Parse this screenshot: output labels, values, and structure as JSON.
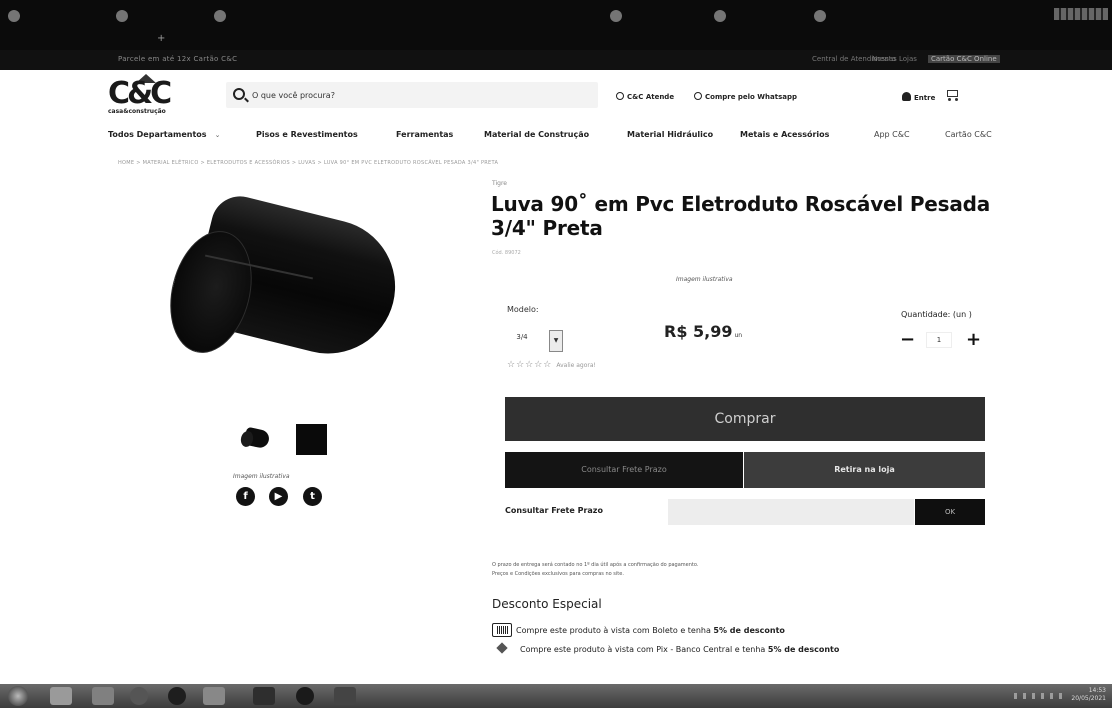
{
  "browser": {
    "tab_count": 6
  },
  "topbar": {
    "promo_text": "Parcele em até 12x Cartão C&C",
    "links": [
      "Central de Atendimento",
      "Nossas Lojas",
      "Cartão C&C Online"
    ]
  },
  "header": {
    "logo": {
      "text": "C&C",
      "tagline": "casa&construção"
    },
    "search_placeholder": "O que você procura?",
    "atende_label": "C&C Atende",
    "whatsapp_label": "Compre pelo Whatsapp",
    "login_label": "Entre"
  },
  "nav": {
    "all_departments": "Todos Departamentos",
    "items": [
      "Pisos e Revestimentos",
      "Ferramentas",
      "Material de Construção",
      "Material Hidráulico",
      "Metais e Acessórios",
      "App C&C",
      "Cartão C&C"
    ]
  },
  "breadcrumb": "HOME > MATERIAL ELÉTRICO > ELETRODUTOS E ACESSÓRIOS > LUVAS > LUVA 90° EM PVC ELETRODUTO ROSCÁVEL PESADA 3/4\" PRETA",
  "product": {
    "brand": "Tigre",
    "title": "Luva 90˚ em Pvc Eletroduto Roscável Pesada 3/4\" Preta",
    "sku": "Cód. 89072",
    "image_caption": "Imagem ilustrativa",
    "model_label": "Modelo:",
    "model_value": "3/4",
    "price": "R$ 5,99",
    "price_unit": "un",
    "quantity_label": "Quantidade: (un )",
    "quantity_value": "1",
    "rating_stars": "☆☆☆☆☆",
    "review_link": "Avalie agora!",
    "buy_button": "Comprar",
    "freight_button": "Consultar Frete Prazo",
    "pickup_button": "Retira na loja",
    "freight_label": "Consultar Frete Prazo",
    "freight_ok": "OK",
    "delivery_note": "O prazo de entrega será contado no 1º dia útil após a confirmação do pagamento.",
    "conditions_note": "Preços e Condições exclusivos para compras no site.",
    "discount_title": "Desconto Especial",
    "discount_boleto_text": "Compre este produto à vista com Boleto e tenha ",
    "discount_boleto_bold": "5% de desconto",
    "discount_pix_text": "Compre este produto à vista com Pix - Banco Central e tenha ",
    "discount_pix_bold": "5% de desconto"
  },
  "social": {
    "facebook": "f",
    "youtube": "▶",
    "twitter": "t"
  },
  "taskbar": {
    "clock_time": "14:53",
    "clock_date": "20/05/2021"
  },
  "colors": {
    "topbar": "#111111",
    "buy_button": "#2f2f2f",
    "freight_button": "#141414",
    "pickup_button": "#3c3c3c"
  }
}
